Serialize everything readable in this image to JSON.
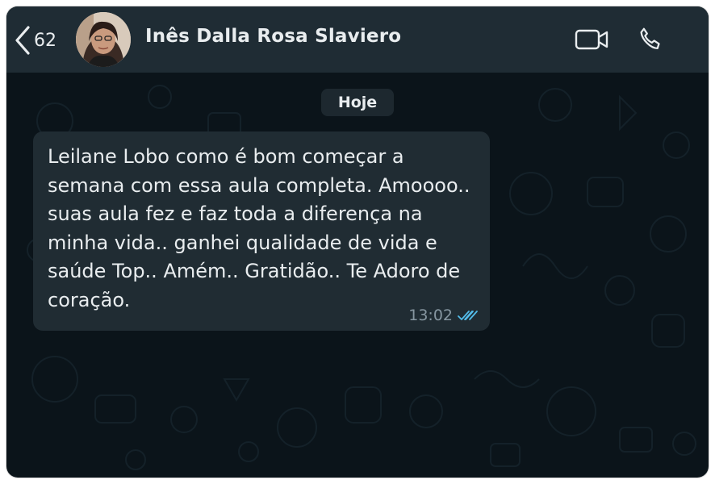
{
  "header": {
    "back_count": "62",
    "contact_name": "Inês Dalla Rosa Slaviero",
    "icons": [
      "chevron-left-icon",
      "video-camera-icon",
      "phone-icon"
    ]
  },
  "chat": {
    "date_label": "Hoje",
    "messages": [
      {
        "text": "Leilane Lobo como é bom começar a\nsemana com essa aula completa. Amoooo..\nsuas aula fez e faz toda a diferença na\nminha vida.. ganhei qualidade de vida e\nsaúde Top.. Amém.. Gratidão.. Te Adoro de\ncoração.",
        "time": "13:02",
        "status": "read",
        "status_icon": "double-check-icon"
      }
    ]
  },
  "colors": {
    "background": "#0b141a",
    "header": "#1f2c34",
    "bubble": "#202c33",
    "read_ticks": "#53bdeb"
  }
}
